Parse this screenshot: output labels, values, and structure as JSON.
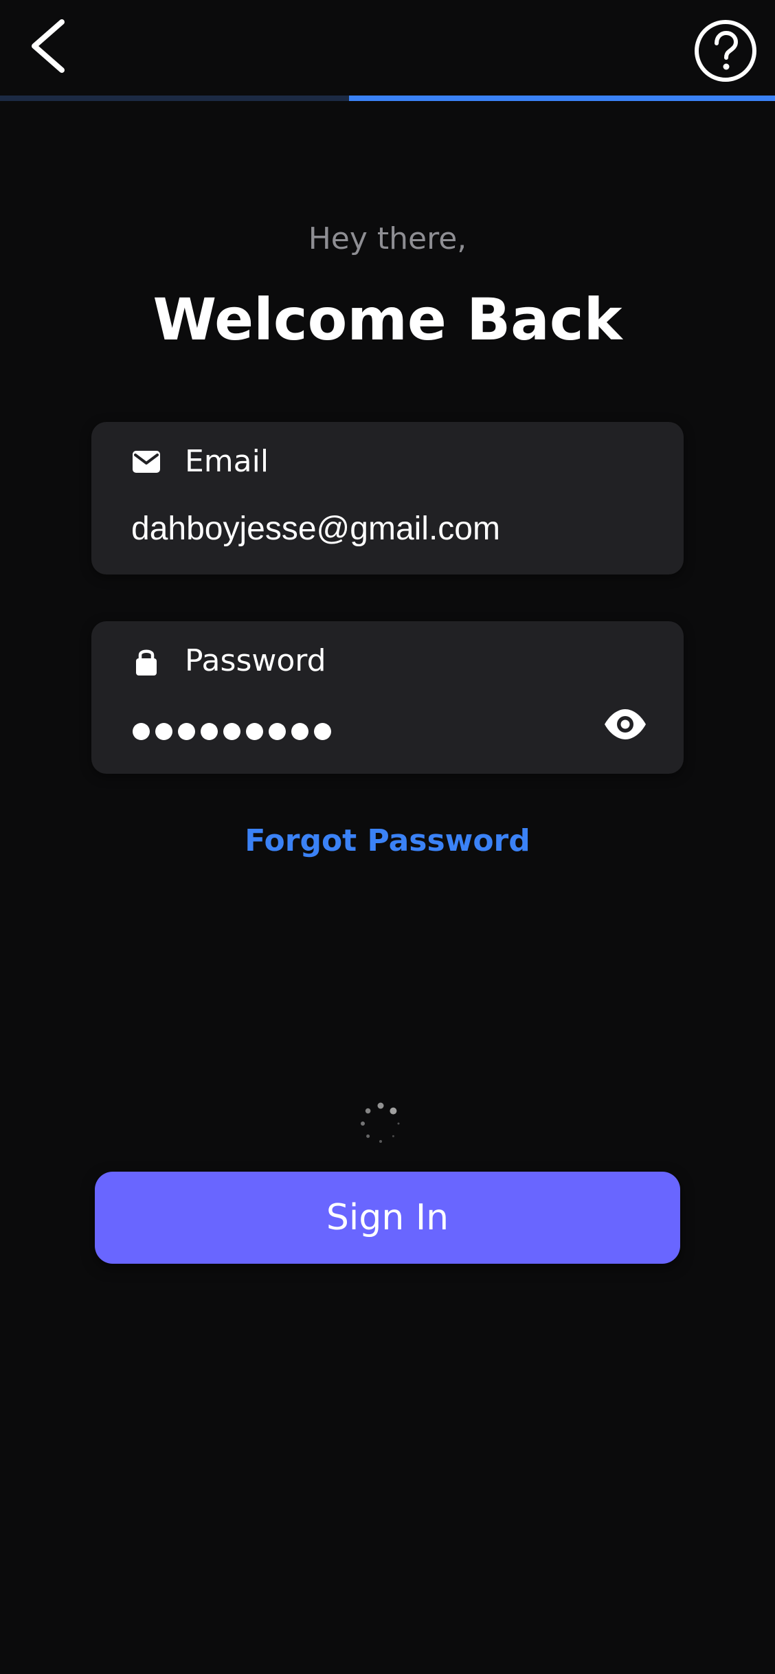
{
  "header": {
    "back_icon": "chevron-left-icon",
    "help_icon": "help-circle-icon"
  },
  "progress": {
    "fraction_complete": 0.55,
    "fill_color": "#3b82f6",
    "track_color": "#1c2a44"
  },
  "greeting": "Hey there,",
  "title": "Welcome Back",
  "email_field": {
    "icon": "mail-icon",
    "label": "Email",
    "value": "dahboyjesse@gmail.com"
  },
  "password_field": {
    "icon": "lock-icon",
    "label": "Password",
    "masked_length": 9,
    "toggle_icon": "eye-icon"
  },
  "forgot_password": "Forgot Password",
  "sign_in_button": "Sign In",
  "colors": {
    "background": "#0b0b0c",
    "field_background": "#212124",
    "accent_link": "#3b82f6",
    "button": "#6966ff",
    "muted_text": "#8e8e93"
  }
}
